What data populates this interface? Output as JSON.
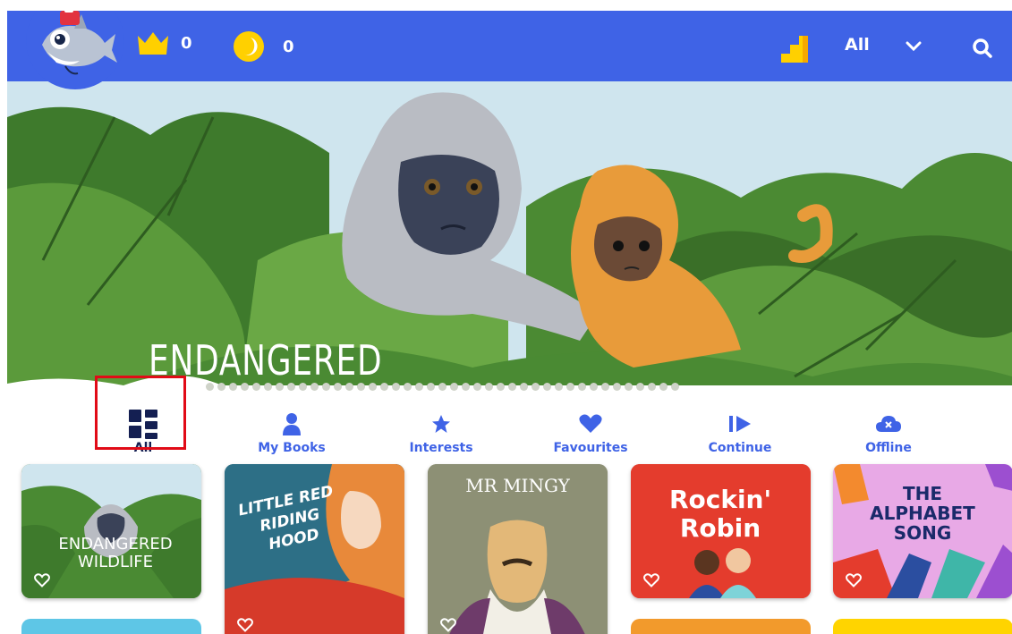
{
  "header": {
    "crowns": "0",
    "coins": "0",
    "filter_label": "All"
  },
  "banner": {
    "title": "ENDANGERED\nWILDLIFE",
    "slide_count": 41
  },
  "nav": {
    "tabs": [
      {
        "label": "All",
        "icon": "grid-icon",
        "active": true
      },
      {
        "label": "My Books",
        "icon": "person-icon",
        "active": false
      },
      {
        "label": "Interests",
        "icon": "star-icon",
        "active": false
      },
      {
        "label": "Favourites",
        "icon": "heart-icon",
        "active": false
      },
      {
        "label": "Continue",
        "icon": "play-icon",
        "active": false
      },
      {
        "label": "Offline",
        "icon": "cloud-off-icon",
        "active": false
      }
    ]
  },
  "books": [
    {
      "title": "ENDANGERED\nWILDLIFE",
      "color": "#5a8b3c"
    },
    {
      "title": "LITTLE RED RIDING HOOD",
      "color": "#2d6f86"
    },
    {
      "title": "MR MINGY",
      "color": "#8d9075"
    },
    {
      "title": "Rockin' Robin",
      "color": "#e43c2d"
    },
    {
      "title": "THE ALPHABET SONG",
      "color": "#e8a9e6"
    }
  ],
  "colors": {
    "primary": "#3f63e6",
    "dark_navy": "#141f52",
    "highlight": "#e10b17",
    "gold": "#ffd000"
  }
}
